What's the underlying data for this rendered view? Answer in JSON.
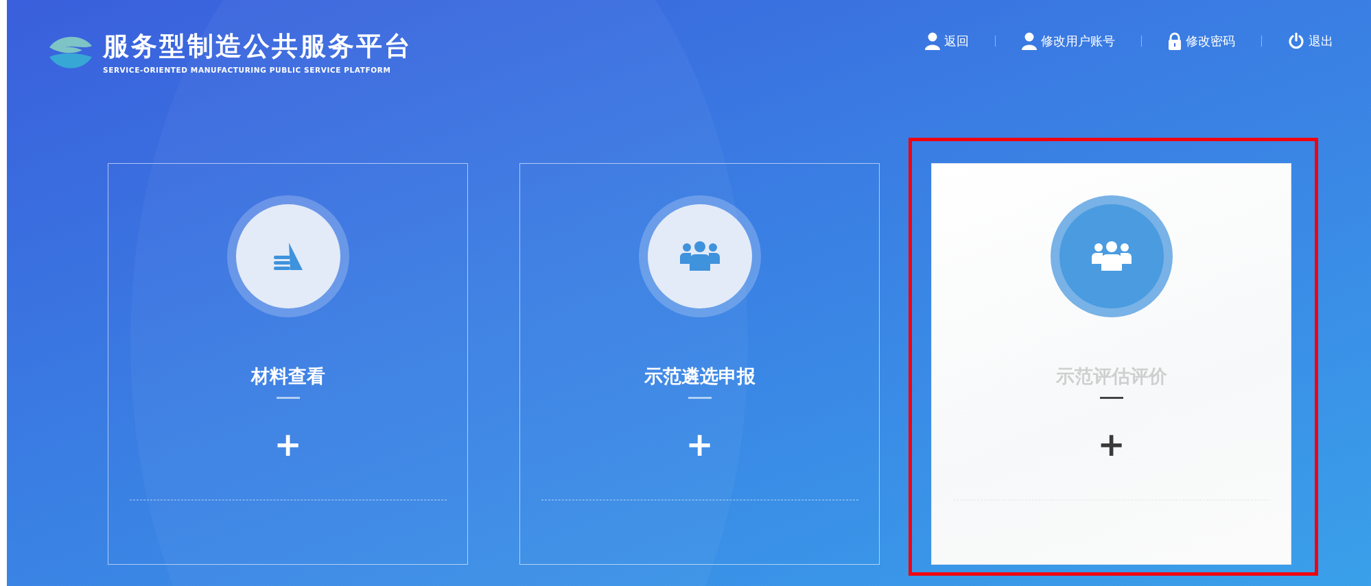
{
  "header": {
    "title": "服务型制造公共服务平台",
    "subtitle": "SERVICE-ORIENTED MANUFACTURING PUBLIC SERVICE PLATFORM"
  },
  "nav": [
    {
      "label": "返回",
      "kind": "user"
    },
    {
      "label": "修改用户账号",
      "kind": "user"
    },
    {
      "label": "修改密码",
      "kind": "lock"
    },
    {
      "label": "退出",
      "kind": "power"
    }
  ],
  "cards": [
    {
      "title": "材料查看",
      "kind": "materials",
      "action": "+",
      "selected": false
    },
    {
      "title": "示范遴选申报",
      "kind": "team",
      "action": "+",
      "selected": false
    },
    {
      "title": "示范评估评价",
      "kind": "team",
      "action": "+",
      "selected": true
    }
  ]
}
